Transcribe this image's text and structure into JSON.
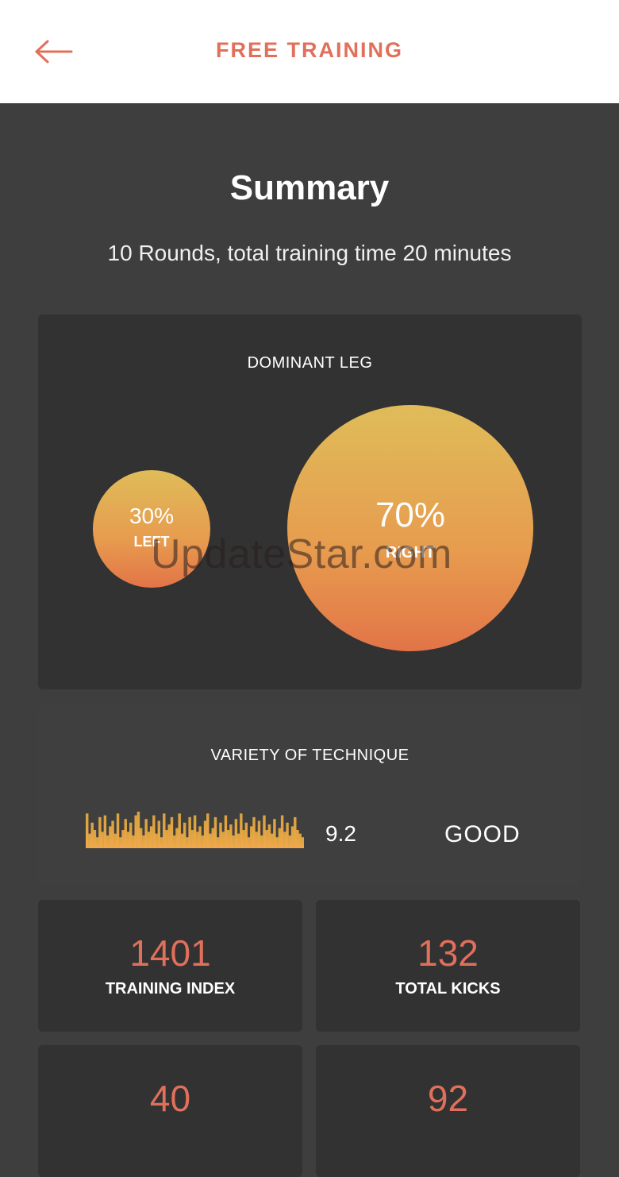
{
  "header": {
    "title": "FREE TRAINING",
    "back_icon": "arrow-left-icon"
  },
  "summary": {
    "title": "Summary",
    "subtitle": "10 Rounds, total training time 20 minutes"
  },
  "dominant_leg": {
    "title": "DOMINANT LEG",
    "left": {
      "percent": "30%",
      "label": "LEFT",
      "value": 30
    },
    "right": {
      "percent": "70%",
      "label": "RIGHT",
      "value": 70
    }
  },
  "variety": {
    "title": "VARIETY OF TECHNIQUE",
    "score": "9.2",
    "rating": "GOOD",
    "bar_levels": [
      0.95,
      0.4,
      0.7,
      0.5,
      0.3,
      0.85,
      0.45,
      0.9,
      0.35,
      0.6,
      0.75,
      0.4,
      0.95,
      0.3,
      0.5,
      0.8,
      0.45,
      0.7,
      0.35,
      0.9,
      1.0,
      0.55,
      0.35,
      0.8,
      0.45,
      0.6,
      0.9,
      0.4,
      0.75,
      0.3,
      0.95,
      0.5,
      0.65,
      0.85,
      0.35,
      0.55,
      0.95,
      0.4,
      0.7,
      0.3,
      0.85,
      0.5,
      0.9,
      0.45,
      0.6,
      0.35,
      0.75,
      0.95,
      0.4,
      0.55,
      0.85,
      0.3,
      0.7,
      0.45,
      0.9,
      0.5,
      0.65,
      0.35,
      0.8,
      0.4,
      0.95,
      0.5,
      0.7,
      0.3,
      0.6,
      0.85,
      0.45,
      0.75,
      0.35,
      0.9,
      0.5,
      0.65,
      0.4,
      0.8,
      0.3,
      0.55,
      0.9,
      0.45,
      0.7,
      0.35,
      0.6,
      0.85,
      0.5,
      0.4,
      0.3
    ],
    "colors": {
      "top": "#d9a23f",
      "bottom": "#f0a94c"
    }
  },
  "stats": [
    {
      "value": "1401",
      "label": "TRAINING INDEX"
    },
    {
      "value": "132",
      "label": "TOTAL KICKS"
    },
    {
      "value": "40",
      "label": ""
    },
    {
      "value": "92",
      "label": ""
    }
  ],
  "colors": {
    "accent": "#e0705b",
    "background": "#3e3e3e",
    "card": "#323232"
  },
  "watermark": "UpdateStar.com"
}
